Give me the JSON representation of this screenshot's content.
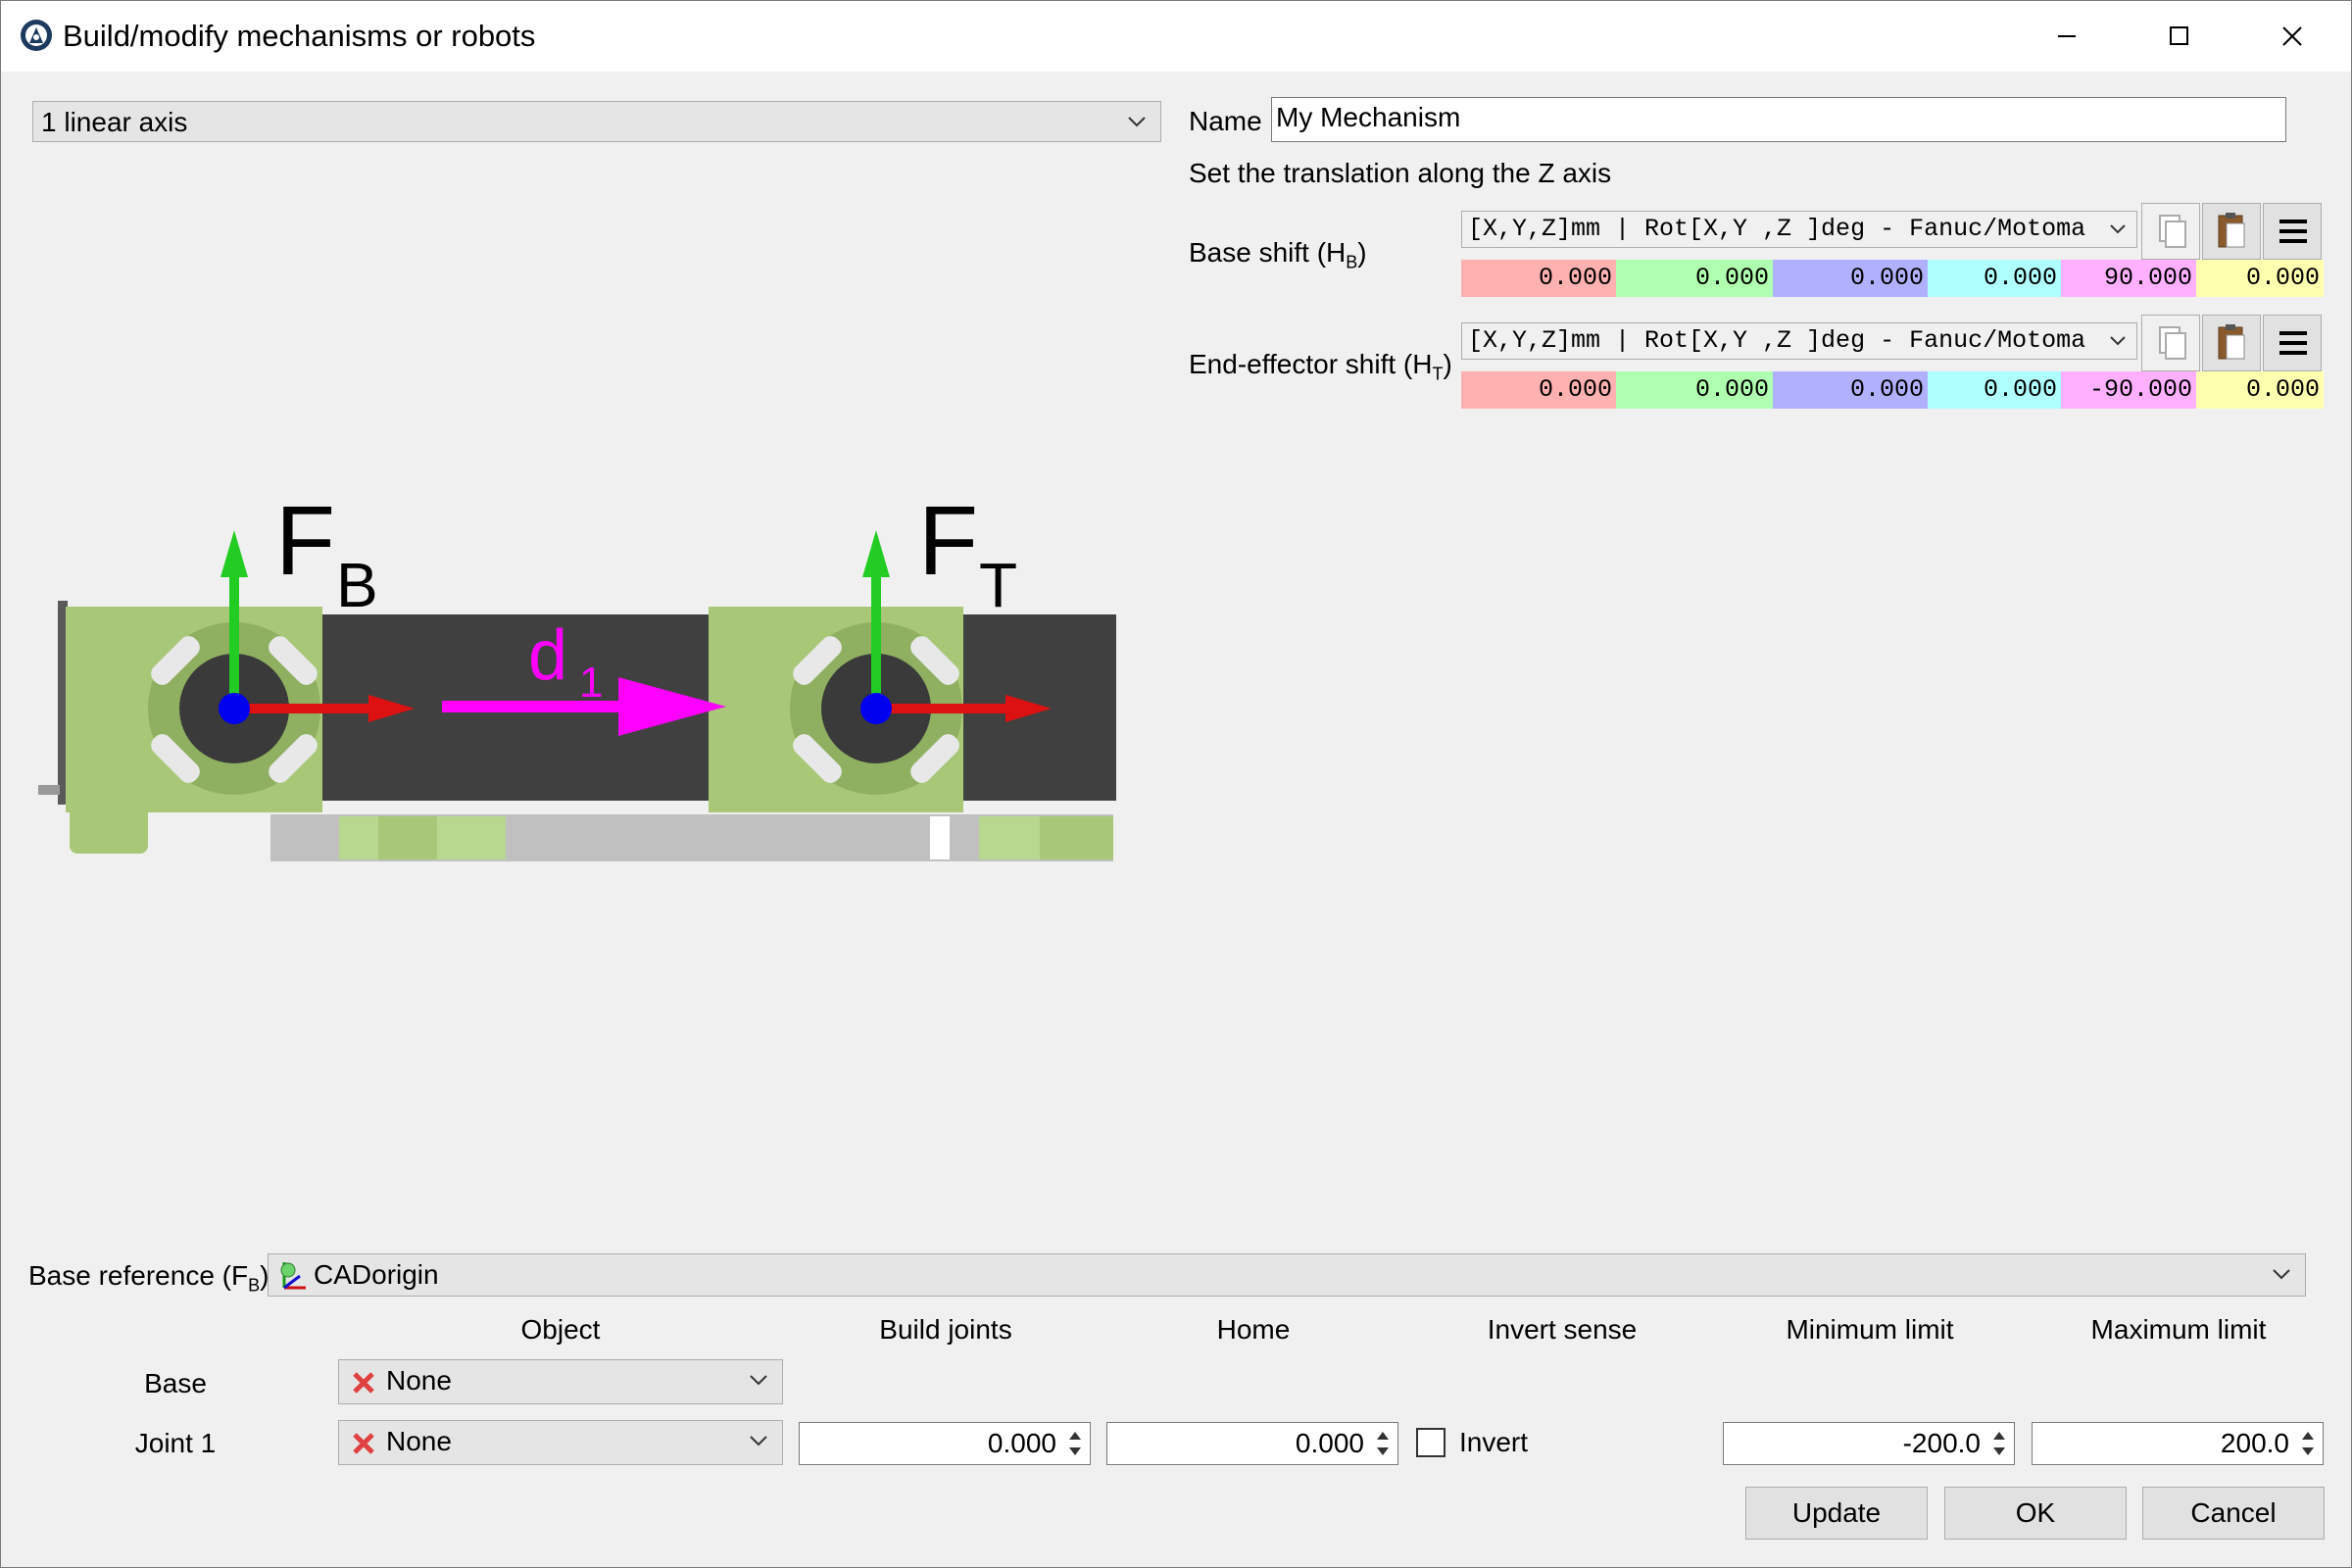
{
  "window": {
    "title": "Build/modify mechanisms or robots",
    "controls": [
      "minimize-icon",
      "maximize-icon",
      "close-icon"
    ]
  },
  "mechanism_type": {
    "selected": "1 linear axis"
  },
  "name": {
    "label": "Name",
    "value": "My Mechanism"
  },
  "hint": "Set the translation along the Z axis",
  "base_shift": {
    "label_main": "Base shift (H",
    "label_sub": "B",
    "label_end": ")",
    "format": "[X,Y,Z]mm | Rot[X,Y ,Z  ]deg - Fanuc/Motoma",
    "values": [
      "0.000",
      "0.000",
      "0.000",
      "0.000",
      "90.000",
      "0.000"
    ]
  },
  "tool_shift": {
    "label_main": "End-effector shift (H",
    "label_sub": "T",
    "label_end": ")",
    "format": "[X,Y,Z]mm | Rot[X,Y ,Z  ]deg - Fanuc/Motoma",
    "values": [
      "0.000",
      "0.000",
      "0.000",
      "0.000",
      "-90.000",
      "0.000"
    ]
  },
  "cell_colors": [
    "#ffb0b0",
    "#b0ffb0",
    "#b0b0ff",
    "#b0ffff",
    "#ffb0ff",
    "#ffffb0"
  ],
  "diagram": {
    "fb_main": "F",
    "fb_sub": "B",
    "ft_main": "F",
    "ft_sub": "T",
    "d_main": "d",
    "d_sub": "1"
  },
  "base_reference": {
    "label_main": "Base reference (F",
    "label_sub": "B",
    "label_end": ")",
    "value": "CADorigin"
  },
  "joints_table": {
    "headers": [
      "Object",
      "Build joints",
      "Home",
      "Invert sense",
      "Minimum limit",
      "Maximum limit"
    ],
    "rows": [
      {
        "label": "Base",
        "object": "None"
      },
      {
        "label": "Joint 1",
        "object": "None",
        "build": "0.000",
        "home": "0.000",
        "invert_label": "Invert",
        "min": "-200.0",
        "max": "200.0"
      }
    ]
  },
  "buttons": {
    "update": "Update",
    "ok": "OK",
    "cancel": "Cancel"
  }
}
